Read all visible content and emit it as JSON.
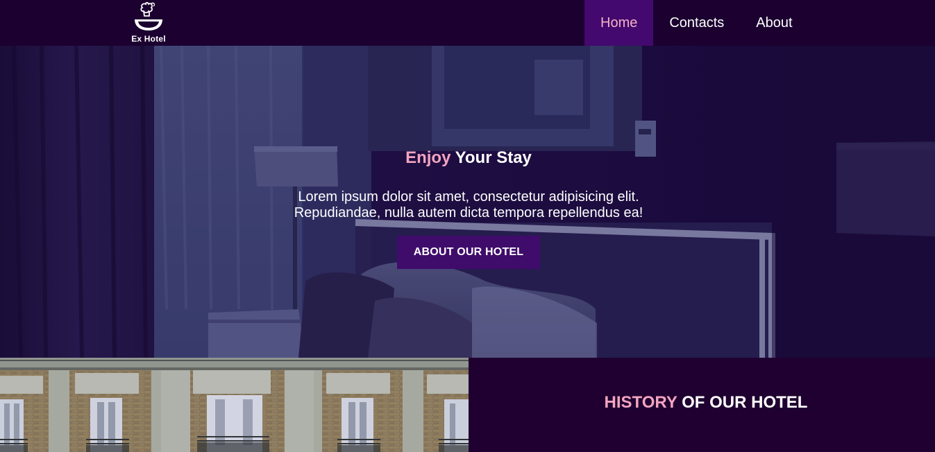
{
  "brand": {
    "name": "Ex Hotel"
  },
  "nav": {
    "items": [
      {
        "label": "Home",
        "active": true
      },
      {
        "label": "Contacts",
        "active": false
      },
      {
        "label": "About",
        "active": false
      }
    ]
  },
  "hero": {
    "title_accent": "Enjoy",
    "title_rest": " Your Stay",
    "text_line1": "Lorem ipsum dolor sit amet, consectetur adipisicing elit.",
    "text_line2": "Repudiandae, nulla autem dicta tempora repellendus ea!",
    "button_label": "ABOUT OUR HOTEL"
  },
  "history": {
    "title_accent": "HISTORY",
    "title_rest": " OF OUR HOTEL"
  },
  "colors": {
    "header_bg": "#1b0030",
    "active_nav_bg": "#44096e",
    "accent_pink": "#f3a4c0",
    "button_bg": "#3f0c6b",
    "section_bg": "#1f0030"
  },
  "icons": {
    "logo": "chef-hat-cloche-icon"
  }
}
